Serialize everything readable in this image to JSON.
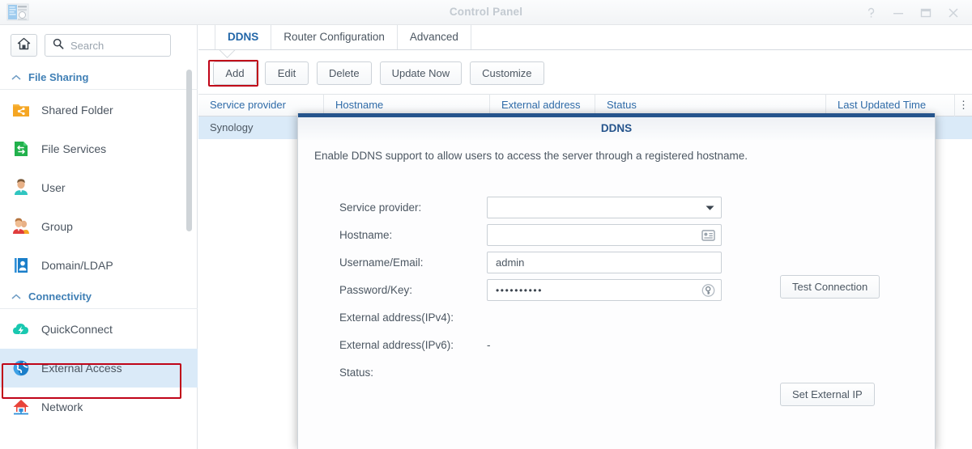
{
  "window": {
    "title": "Control Panel",
    "app_icon": "control-panel-icon",
    "buttons": [
      {
        "name": "help-button",
        "glyph": "?"
      },
      {
        "name": "minimize-button",
        "glyph": "–"
      },
      {
        "name": "maximize-button",
        "glyph": "▭"
      },
      {
        "name": "close-button",
        "glyph": "✕"
      }
    ]
  },
  "sidebar": {
    "home_icon": "home-icon",
    "search": {
      "placeholder": "Search",
      "icon": "search-icon"
    },
    "groups": [
      {
        "label": "File Sharing",
        "chevron": "chevron-up-icon",
        "items": [
          {
            "label": "Shared Folder",
            "icon": "shared-folder-icon"
          },
          {
            "label": "File Services",
            "icon": "file-services-icon"
          },
          {
            "label": "User",
            "icon": "user-icon"
          },
          {
            "label": "Group",
            "icon": "group-icon"
          },
          {
            "label": "Domain/LDAP",
            "icon": "domain-ldap-icon"
          }
        ]
      },
      {
        "label": "Connectivity",
        "chevron": "chevron-up-icon",
        "items": [
          {
            "label": "QuickConnect",
            "icon": "quickconnect-icon"
          },
          {
            "label": "External Access",
            "icon": "external-access-icon",
            "selected": true,
            "highlighted": true
          },
          {
            "label": "Network",
            "icon": "network-icon"
          }
        ]
      }
    ]
  },
  "content": {
    "tabs": [
      {
        "label": "DDNS",
        "active": true
      },
      {
        "label": "Router Configuration",
        "active": false
      },
      {
        "label": "Advanced",
        "active": false
      }
    ],
    "toolbar": [
      {
        "label": "Add",
        "highlighted": true
      },
      {
        "label": "Edit",
        "highlighted": false
      },
      {
        "label": "Delete",
        "highlighted": false
      },
      {
        "label": "Update Now",
        "highlighted": false
      },
      {
        "label": "Customize",
        "highlighted": false
      }
    ],
    "table": {
      "columns": [
        "Service provider",
        "Hostname",
        "External address",
        "Status",
        "Last Updated Time"
      ],
      "column_menu_icon": "column-menu-icon",
      "rows": [
        {
          "service_provider": "Synology",
          "hostname": "",
          "external_address": "",
          "status": "",
          "last_updated_time": "",
          "selected": true
        }
      ]
    }
  },
  "dialog": {
    "title": "DDNS",
    "description": "Enable DDNS support to allow users to access the server through a registered hostname.",
    "fields": [
      {
        "label": "Service provider:",
        "value": "",
        "type": "select",
        "icon": "chevron-down-icon"
      },
      {
        "label": "Hostname:",
        "value": "",
        "type": "text",
        "icon": "address-book-icon"
      },
      {
        "label": "Username/Email:",
        "value": "admin",
        "type": "text",
        "icon": ""
      },
      {
        "label": "Password/Key:",
        "value": "••••••••••",
        "type": "password",
        "icon": "key-icon"
      }
    ],
    "readonly_rows": [
      {
        "label": "External address(IPv4):",
        "value": ""
      },
      {
        "label": "External address(IPv6):",
        "value": "-"
      },
      {
        "label": "Status:",
        "value": ""
      }
    ],
    "buttons": [
      {
        "name": "test-connection-button",
        "label": "Test Connection"
      },
      {
        "name": "set-external-ip-button",
        "label": "Set External IP"
      }
    ]
  },
  "colors": {
    "accent_blue": "#2266a8",
    "dialog_bar": "#25548c",
    "selection": "#daeaf8",
    "highlight_red": "#c00418"
  }
}
